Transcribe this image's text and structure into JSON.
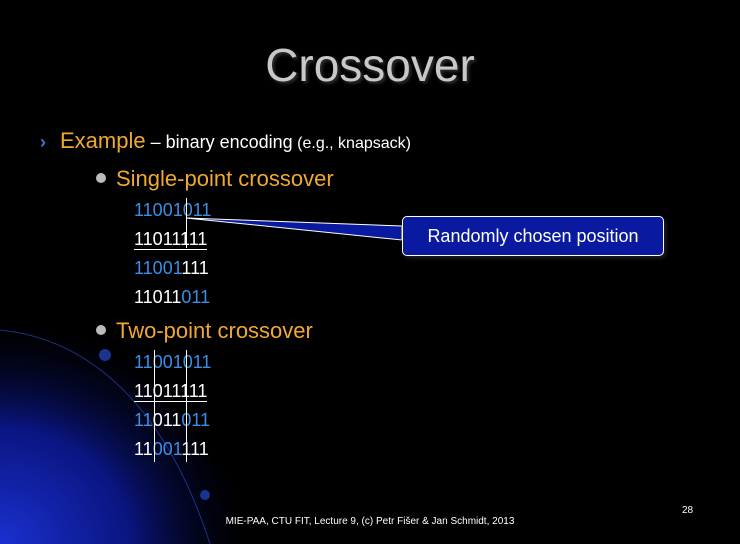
{
  "slide": {
    "title": "Crossover",
    "main_bullet": {
      "highlight": "Example",
      "rest": " – binary encoding",
      "small": " (e.g., knapsack)"
    },
    "single_point": {
      "label": "Single-point crossover",
      "rows": [
        {
          "a": "11001",
          "b": "011"
        },
        {
          "a": "11011",
          "b": "111"
        },
        {
          "a": "11001",
          "b": "111"
        },
        {
          "a": "11011",
          "b": "011"
        }
      ]
    },
    "callout": "Randomly chosen position",
    "two_point": {
      "label": "Two-point crossover",
      "rows": [
        {
          "a": "11",
          "b": "001",
          "c": "011"
        },
        {
          "a": "11",
          "b": "011",
          "c": "111"
        },
        {
          "a": "11",
          "b": "011",
          "c": "011"
        },
        {
          "a": "11",
          "b": "001",
          "c": "111"
        }
      ]
    },
    "footer": "MIE-PAA, CTU FIT, Lecture 9, (c) Petr Fišer & Jan Schmidt, 2013",
    "page_number": "28",
    "colors": {
      "accent": "#f0a830",
      "blue_bits": "#3a8ee8",
      "callout_bg": "#0a1aa0"
    }
  }
}
